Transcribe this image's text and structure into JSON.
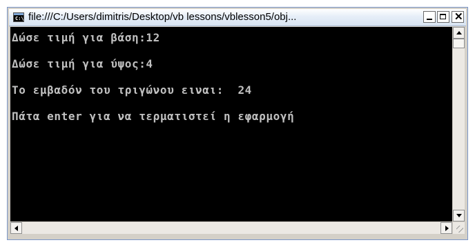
{
  "window": {
    "title": "file:///C:/Users/dimitris/Desktop/vb lessons/vblesson5/obj...",
    "icon_text": "C:\\"
  },
  "controls": {
    "minimize": "minimize-icon",
    "maximize": "maximize-icon",
    "close": "close-icon",
    "close_glyph": "✕"
  },
  "console": {
    "lines": [
      "Δώσε τιμή για βάση:12",
      "Δώσε τιμή για ύψος:4",
      "Το εμβαδόν του τριγώνου ειναι:  24",
      "Πάτα enter για να τερματιστεί η εφαρμογή"
    ],
    "foreground": "#c0c0c0",
    "background": "#000000"
  }
}
